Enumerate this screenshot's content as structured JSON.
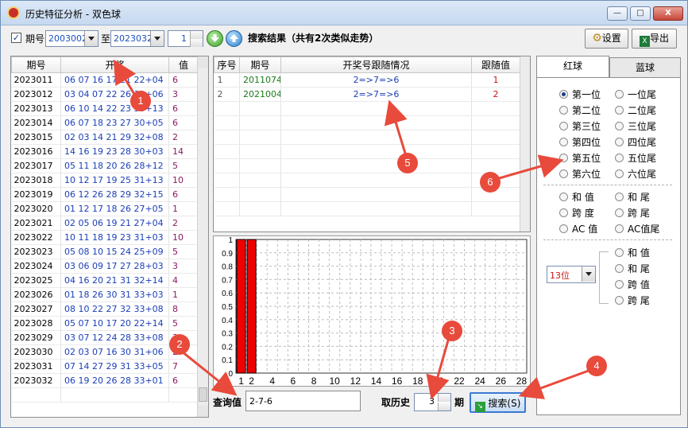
{
  "window": {
    "title": "历史特征分析 - 双色球",
    "buttons": {
      "minimize": "—",
      "maximize": "□",
      "close": "X"
    }
  },
  "toolbar": {
    "period_checkbox_label": "期号",
    "period_from": "2003002",
    "to_label": "至",
    "period_to": "2023032",
    "step_value": "1",
    "result_text": "搜索结果（共有2次类似走势）",
    "settings_label": "设置",
    "export_label": "导出"
  },
  "history_table": {
    "headers": [
      "期号",
      "开奖",
      "值"
    ],
    "rows": [
      [
        "2023011",
        "06 07 16 17 21 22+04",
        "6"
      ],
      [
        "2023012",
        "03 04 07 22 26 30+06",
        "3"
      ],
      [
        "2023013",
        "06 10 14 22 23 33+13",
        "6"
      ],
      [
        "2023014",
        "06 07 18 23 27 30+05",
        "6"
      ],
      [
        "2023015",
        "02 03 14 21 29 32+08",
        "2"
      ],
      [
        "2023016",
        "14 16 19 23 28 30+03",
        "14"
      ],
      [
        "2023017",
        "05 11 18 20 26 28+12",
        "5"
      ],
      [
        "2023018",
        "10 12 17 19 25 31+13",
        "10"
      ],
      [
        "2023019",
        "06 12 26 28 29 32+15",
        "6"
      ],
      [
        "2023020",
        "01 12 17 18 26 27+05",
        "1"
      ],
      [
        "2023021",
        "02 05 06 19 21 27+04",
        "2"
      ],
      [
        "2023022",
        "10 11 18 19 23 31+03",
        "10"
      ],
      [
        "2023023",
        "05 08 10 15 24 25+09",
        "5"
      ],
      [
        "2023024",
        "03 06 09 17 27 28+03",
        "3"
      ],
      [
        "2023025",
        "04 16 20 21 31 32+14",
        "4"
      ],
      [
        "2023026",
        "01 18 26 30 31 33+03",
        "1"
      ],
      [
        "2023027",
        "08 10 22 27 32 33+08",
        "8"
      ],
      [
        "2023028",
        "05 07 10 17 20 22+14",
        "5"
      ],
      [
        "2023029",
        "03 07 12 24 28 33+08",
        "3"
      ],
      [
        "2023030",
        "02 03 07 16 30 31+06",
        "2"
      ],
      [
        "2023031",
        "07 14 27 29 31 33+05",
        "7"
      ],
      [
        "2023032",
        "06 19 20 26 28 33+01",
        "6"
      ]
    ]
  },
  "result_table": {
    "headers": [
      "序号",
      "期号",
      "开奖号跟随情况",
      "跟随值"
    ],
    "rows": [
      [
        "1",
        "2011074",
        "2=>7=>6",
        "1"
      ],
      [
        "2",
        "2021004",
        "2=>7=>6",
        "2"
      ]
    ]
  },
  "chart_data": {
    "type": "bar",
    "categories": [
      "1",
      "2",
      "3",
      "4",
      "5",
      "6",
      "7",
      "8",
      "9",
      "10",
      "11",
      "12",
      "13",
      "14",
      "15",
      "16",
      "17",
      "18",
      "19",
      "20",
      "21",
      "22",
      "23",
      "24",
      "25",
      "26",
      "27",
      "28"
    ],
    "values": [
      1,
      1,
      0,
      0,
      0,
      0,
      0,
      0,
      0,
      0,
      0,
      0,
      0,
      0,
      0,
      0,
      0,
      0,
      0,
      0,
      0,
      0,
      0,
      0,
      0,
      0,
      0,
      0
    ],
    "x_tick_labels": [
      "1",
      "2",
      "4",
      "6",
      "8",
      "10",
      "12",
      "14",
      "16",
      "18",
      "20",
      "22",
      "24",
      "26",
      "28"
    ],
    "y_tick_labels": [
      "0",
      "0.1",
      "0.2",
      "0.3",
      "0.4",
      "0.5",
      "0.6",
      "0.7",
      "0.8",
      "0.9",
      "1"
    ],
    "ylim": [
      0,
      1
    ],
    "grid": true,
    "bar_color": "#ee0000"
  },
  "query": {
    "label": "查询值",
    "value": "2-7-6",
    "history_label": "取历史",
    "history_value": "3",
    "period_unit": "期",
    "search_label": "搜索(S)"
  },
  "right_panel": {
    "tabs": [
      "红球",
      "蓝球"
    ],
    "positions": [
      [
        "第一位",
        "一位尾"
      ],
      [
        "第二位",
        "二位尾"
      ],
      [
        "第三位",
        "三位尾"
      ],
      [
        "第四位",
        "四位尾"
      ],
      [
        "第五位",
        "五位尾"
      ],
      [
        "第六位",
        "六位尾"
      ]
    ],
    "stats": [
      [
        "和 值",
        "和 尾"
      ],
      [
        "跨 度",
        "跨 尾"
      ],
      [
        "AC 值",
        "AC值尾"
      ]
    ],
    "combo_value": "13位",
    "combo_options": [
      "和 值",
      "和 尾",
      "跨 值",
      "跨 尾"
    ]
  },
  "annotations": [
    "1",
    "2",
    "3",
    "4",
    "5",
    "6"
  ],
  "colors": {
    "annotation": "#e84a3b",
    "number_blue": "#1b3fb8",
    "value_purple": "#8a1a62",
    "result_green": "#1a7a1a",
    "follow_red": "#c81414"
  }
}
